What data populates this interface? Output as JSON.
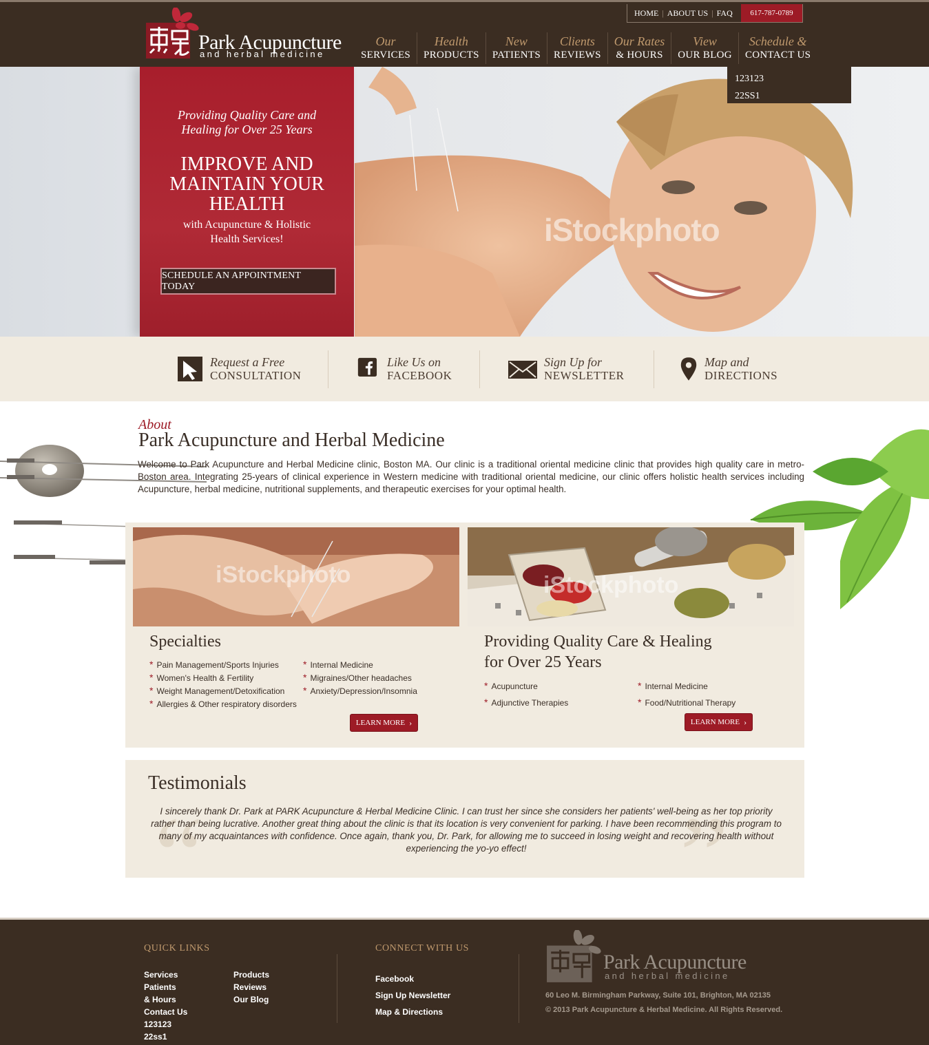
{
  "brand": {
    "name": "Park Acupuncture",
    "subtitle": "and herbal medicine",
    "accent_color": "#9d1b26",
    "header_color": "#3b2d22",
    "cream_color": "#f1ebe0"
  },
  "topbar": {
    "links": [
      "HOME",
      "ABOUT US",
      "FAQ"
    ],
    "phone": "617-787-0789"
  },
  "nav": [
    {
      "line1": "Our",
      "line2": "SERVICES"
    },
    {
      "line1": "Health",
      "line2": "PRODUCTS"
    },
    {
      "line1": "New",
      "line2": "PATIENTS"
    },
    {
      "line1": "Clients",
      "line2": "REVIEWS"
    },
    {
      "line1": "Our Rates",
      "line2": "& HOURS"
    },
    {
      "line1": "View",
      "line2": "OUR BLOG"
    },
    {
      "line1": "Schedule &",
      "line2": "CONTACT US"
    }
  ],
  "dropdown": [
    "123123",
    "22SS1"
  ],
  "hero": {
    "tagline_1": "Providing Quality Care  and",
    "tagline_2": "Healing for Over 25 Years",
    "headline": "IMPROVE AND MAINTAIN YOUR HEALTH",
    "sub_1": "with Acupuncture & Holistic",
    "sub_2": "Health Services!",
    "cta": "SCHEDULE AN APPOINTMENT TODAY",
    "watermark": "iStockphoto"
  },
  "actions": [
    {
      "line1": "Request a Free",
      "line2": "CONSULTATION",
      "icon": "cursor-arrow-icon"
    },
    {
      "line1": "Like Us on",
      "line2": "FACEBOOK",
      "icon": "facebook-icon"
    },
    {
      "line1": "Sign Up for",
      "line2": "NEWSLETTER",
      "icon": "envelope-icon"
    },
    {
      "line1": "Map and",
      "line2": "DIRECTIONS",
      "icon": "map-pin-icon"
    }
  ],
  "about": {
    "kicker": "About",
    "title": "Park Acupuncture and Herbal Medicine",
    "text": "Welcome to Park Acupuncture and Herbal Medicine clinic, Boston MA. Our clinic is a traditional oriental medicine clinic that provides high quality care in metro-Boston area. Integrating 25-years of clinical experience in Western medicine with traditional oriental medicine, our clinic offers holistic health services including Acupuncture, herbal medicine, nutritional supplements, and therapeutic exercises for your optimal health."
  },
  "specialties": {
    "title": "Specialties",
    "col1": [
      "Pain Management/Sports Injuries",
      "Women's Health & Fertility",
      "Weight Management/Detoxification",
      "Allergies & Other respiratory disorders"
    ],
    "col2": [
      "Internal Medicine",
      "Migraines/Other headaches",
      "Anxiety/Depression/Insomnia"
    ],
    "button": "LEARN MORE"
  },
  "quality": {
    "title_1": "Providing Quality Care & Healing",
    "title_2": "for Over 25 Years",
    "col1": [
      "Acupuncture",
      "Adjunctive Therapies"
    ],
    "col2": [
      "Internal Medicine",
      "Food/Nutritional Therapy"
    ],
    "button": "LEARN MORE"
  },
  "testimonials": {
    "title": "Testimonials",
    "text": "I sincerely thank Dr. Park at PARK Acupuncture & Herbal Medicine Clinic. I can trust her since she considers her patients' well-being as her top priority rather than being lucrative. Another great thing about the clinic is that its location is very convenient for parking. I have been recommending this program to many of my acquaintances with confidence. Once again, thank you, Dr. Park, for allowing me to succeed in losing weight and recovering health without experiencing the yo-yo effect!"
  },
  "footer": {
    "quick_links_title": "QUICK LINKS",
    "quick_col1": [
      "Services",
      "Patients",
      "& Hours",
      "Contact Us",
      "123123",
      "22ss1"
    ],
    "quick_col2": [
      "Products",
      "Reviews",
      "Our Blog"
    ],
    "connect_title": "CONNECT WITH US",
    "connect": [
      "Facebook",
      "Sign Up Newsletter",
      "Map & Directions"
    ],
    "address": "60 Leo M. Birmingham Parkway, Suite 101, Brighton, MA 02135",
    "copyright": "© 2013 Park Acupuncture & Herbal Medicine. All Rights Reserved."
  }
}
